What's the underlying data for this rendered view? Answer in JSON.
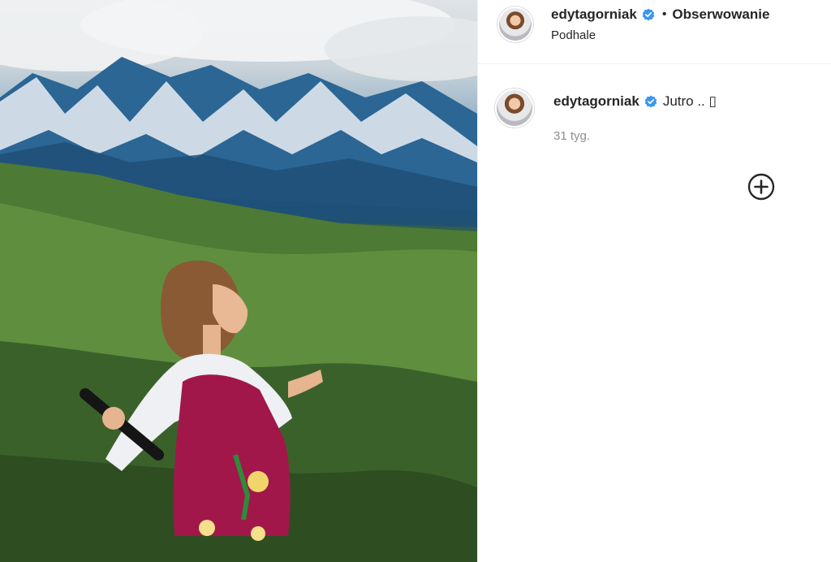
{
  "post": {
    "author": "edytagorniak",
    "follow_label": "Obserwowanie",
    "separator": "•",
    "location": "Podhale"
  },
  "caption": {
    "author": "edytagorniak",
    "text": "Jutro .. ▯",
    "time": "31 tyg."
  },
  "icons": {
    "verified": "verified-badge-icon",
    "add": "plus-circle-icon"
  },
  "colors": {
    "verified": "#3897f0",
    "secondary_text": "#8e8e8e",
    "primary_text": "#262626"
  }
}
